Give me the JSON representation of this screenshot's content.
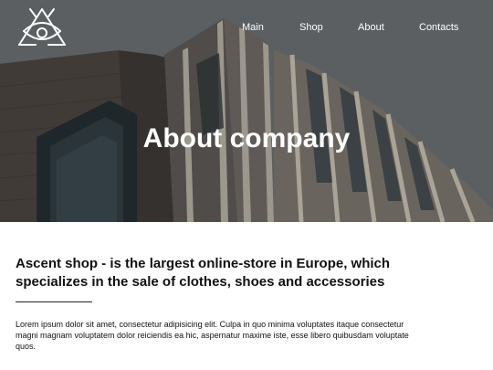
{
  "nav": {
    "items": [
      {
        "label": "Main"
      },
      {
        "label": "Shop"
      },
      {
        "label": "About"
      },
      {
        "label": "Contacts"
      }
    ]
  },
  "logo": {
    "icon": "eye-triangle-icon"
  },
  "hero": {
    "title": "About company"
  },
  "about": {
    "heading": "Ascent shop - is the largest online-store in Europe, which specializes in the sale of clothes, shoes and accessories",
    "paragraph": "Lorem ipsum dolor sit amet, consectetur adipisicing elit. Culpa in quo minima voluptates itaque consectetur magni magnam voluptatem dolor reiciendis ea hic, aspernatur maxime iste, esse libero quibusdam voluptate quos."
  },
  "colors": {
    "text": "#111111",
    "nav_text": "#ffffff",
    "background": "#ffffff"
  }
}
